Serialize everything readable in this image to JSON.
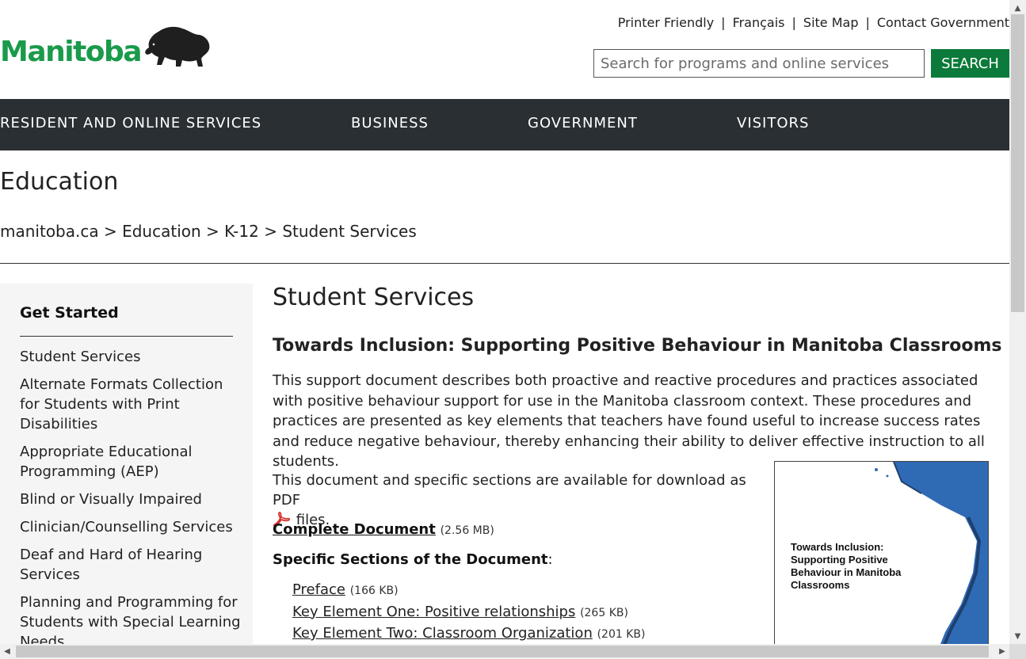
{
  "header": {
    "logo_text": "Manitoba",
    "util_links": [
      "Printer Friendly",
      "Français",
      "Site Map",
      "Contact Government"
    ],
    "search": {
      "placeholder": "Search for programs and online services",
      "value": "",
      "button_label": "SEARCH"
    }
  },
  "main_nav": [
    "RESIDENT AND ONLINE SERVICES",
    "BUSINESS",
    "GOVERNMENT",
    "VISITORS"
  ],
  "section_title": "Education",
  "breadcrumb": {
    "items": [
      "manitoba.ca",
      "Education",
      "K-12",
      "Student Services"
    ],
    "separator": ">"
  },
  "sidebar": {
    "heading": "Get Started",
    "items": [
      "Student Services",
      "Alternate Formats Collection for Students with Print Disabilities",
      "Appropriate Educational Programming (AEP)",
      "Blind or Visually Impaired",
      "Clinician/Counselling Services",
      "Deaf and Hard of Hearing Services",
      "Planning and Programming for Students with Special Learning Needs"
    ]
  },
  "main": {
    "page_title": "Student Services",
    "doc_title": "Towards Inclusion: Supporting Positive Behaviour in Manitoba Classrooms",
    "intro": "This support document describes both proactive and reactive procedures and practices associated with positive behaviour support for use in the Manitoba classroom context. These procedures and practices are presented as key elements that teachers have found useful to increase success rates and reduce negative behaviour, thereby enhancing their ability to deliver effective instruction to all students.",
    "availability_text": "This document and specific sections are available for download as PDF",
    "availability_suffix": "files.",
    "complete_document": {
      "label": "Complete Document",
      "size": "(2.56 MB)"
    },
    "specific_heading": "Specific Sections of the Document",
    "specific_colon": ":",
    "sections": [
      {
        "label": "Preface",
        "size": "(166 KB)"
      },
      {
        "label": "Key Element One: Positive relationships",
        "size": "(265 KB)"
      },
      {
        "label": "Key Element Two: Classroom Organization",
        "size": "(201 KB)"
      }
    ],
    "cover_title": "Towards Inclusion: Supporting Positive Behaviour in Manitoba Classrooms"
  },
  "colors": {
    "brand_green": "#1a9a4a",
    "search_button": "#0b7a3a",
    "nav_bg": "#2a2f33",
    "sidebar_bg": "#f5f5f5",
    "cover_blue": "#2f6bb5"
  },
  "icons": [
    "bison-logo-icon",
    "pdf-icon",
    "scroll-up-icon",
    "scroll-down-icon",
    "scroll-left-icon",
    "scroll-right-icon"
  ]
}
